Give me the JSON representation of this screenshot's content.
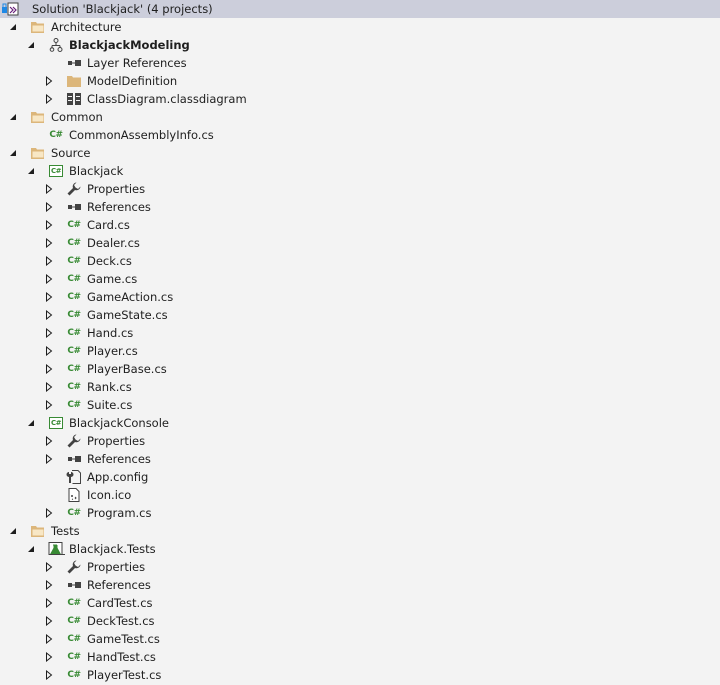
{
  "solution_explorer": {
    "items": [
      {
        "label": "Solution 'Blackjack' (4 projects)",
        "icon": "solution-icon",
        "level": 0,
        "expander": "none",
        "selected": true
      },
      {
        "label": "Architecture",
        "icon": "folder-open-icon",
        "level": 1,
        "expander": "expanded"
      },
      {
        "label": "BlackjackModeling",
        "icon": "modeling-project-icon",
        "level": 2,
        "expander": "expanded",
        "bold": true
      },
      {
        "label": "Layer References",
        "icon": "references-icon",
        "level": 3,
        "expander": "none"
      },
      {
        "label": "ModelDefinition",
        "icon": "folder-icon",
        "level": 3,
        "expander": "collapsed"
      },
      {
        "label": "ClassDiagram.classdiagram",
        "icon": "class-diagram-icon",
        "level": 3,
        "expander": "collapsed"
      },
      {
        "label": "Common",
        "icon": "folder-open-icon",
        "level": 1,
        "expander": "expanded"
      },
      {
        "label": "CommonAssemblyInfo.cs",
        "icon": "csharp-file-icon",
        "level": 2,
        "expander": "none"
      },
      {
        "label": "Source",
        "icon": "folder-open-icon",
        "level": 1,
        "expander": "expanded"
      },
      {
        "label": "Blackjack",
        "icon": "csharp-project-icon",
        "level": 2,
        "expander": "expanded"
      },
      {
        "label": "Properties",
        "icon": "wrench-icon",
        "level": 3,
        "expander": "collapsed"
      },
      {
        "label": "References",
        "icon": "references-icon",
        "level": 3,
        "expander": "collapsed"
      },
      {
        "label": "Card.cs",
        "icon": "csharp-file-icon",
        "level": 3,
        "expander": "collapsed"
      },
      {
        "label": "Dealer.cs",
        "icon": "csharp-file-icon",
        "level": 3,
        "expander": "collapsed"
      },
      {
        "label": "Deck.cs",
        "icon": "csharp-file-icon",
        "level": 3,
        "expander": "collapsed"
      },
      {
        "label": "Game.cs",
        "icon": "csharp-file-icon",
        "level": 3,
        "expander": "collapsed"
      },
      {
        "label": "GameAction.cs",
        "icon": "csharp-file-icon",
        "level": 3,
        "expander": "collapsed"
      },
      {
        "label": "GameState.cs",
        "icon": "csharp-file-icon",
        "level": 3,
        "expander": "collapsed"
      },
      {
        "label": "Hand.cs",
        "icon": "csharp-file-icon",
        "level": 3,
        "expander": "collapsed"
      },
      {
        "label": "Player.cs",
        "icon": "csharp-file-icon",
        "level": 3,
        "expander": "collapsed"
      },
      {
        "label": "PlayerBase.cs",
        "icon": "csharp-file-icon",
        "level": 3,
        "expander": "collapsed"
      },
      {
        "label": "Rank.cs",
        "icon": "csharp-file-icon",
        "level": 3,
        "expander": "collapsed"
      },
      {
        "label": "Suite.cs",
        "icon": "csharp-file-icon",
        "level": 3,
        "expander": "collapsed"
      },
      {
        "label": "BlackjackConsole",
        "icon": "csharp-project-icon",
        "level": 2,
        "expander": "expanded"
      },
      {
        "label": "Properties",
        "icon": "wrench-icon",
        "level": 3,
        "expander": "collapsed"
      },
      {
        "label": "References",
        "icon": "references-icon",
        "level": 3,
        "expander": "collapsed"
      },
      {
        "label": "App.config",
        "icon": "config-file-icon",
        "level": 3,
        "expander": "none"
      },
      {
        "label": "Icon.ico",
        "icon": "icon-file-icon",
        "level": 3,
        "expander": "none"
      },
      {
        "label": "Program.cs",
        "icon": "csharp-file-icon",
        "level": 3,
        "expander": "collapsed"
      },
      {
        "label": "Tests",
        "icon": "folder-open-icon",
        "level": 1,
        "expander": "expanded"
      },
      {
        "label": "Blackjack.Tests",
        "icon": "test-project-icon",
        "level": 2,
        "expander": "expanded"
      },
      {
        "label": "Properties",
        "icon": "wrench-icon",
        "level": 3,
        "expander": "collapsed"
      },
      {
        "label": "References",
        "icon": "references-icon",
        "level": 3,
        "expander": "collapsed"
      },
      {
        "label": "CardTest.cs",
        "icon": "csharp-file-icon",
        "level": 3,
        "expander": "collapsed"
      },
      {
        "label": "DeckTest.cs",
        "icon": "csharp-file-icon",
        "level": 3,
        "expander": "collapsed"
      },
      {
        "label": "GameTest.cs",
        "icon": "csharp-file-icon",
        "level": 3,
        "expander": "collapsed"
      },
      {
        "label": "HandTest.cs",
        "icon": "csharp-file-icon",
        "level": 3,
        "expander": "collapsed"
      },
      {
        "label": "PlayerTest.cs",
        "icon": "csharp-file-icon",
        "level": 3,
        "expander": "collapsed"
      }
    ],
    "colors": {
      "background": "#f3f3f3",
      "selection": "#cccedb",
      "csharp_green": "#388a34",
      "folder": "#dcb67a"
    },
    "glyphs": {
      "csharp": "C#"
    }
  }
}
